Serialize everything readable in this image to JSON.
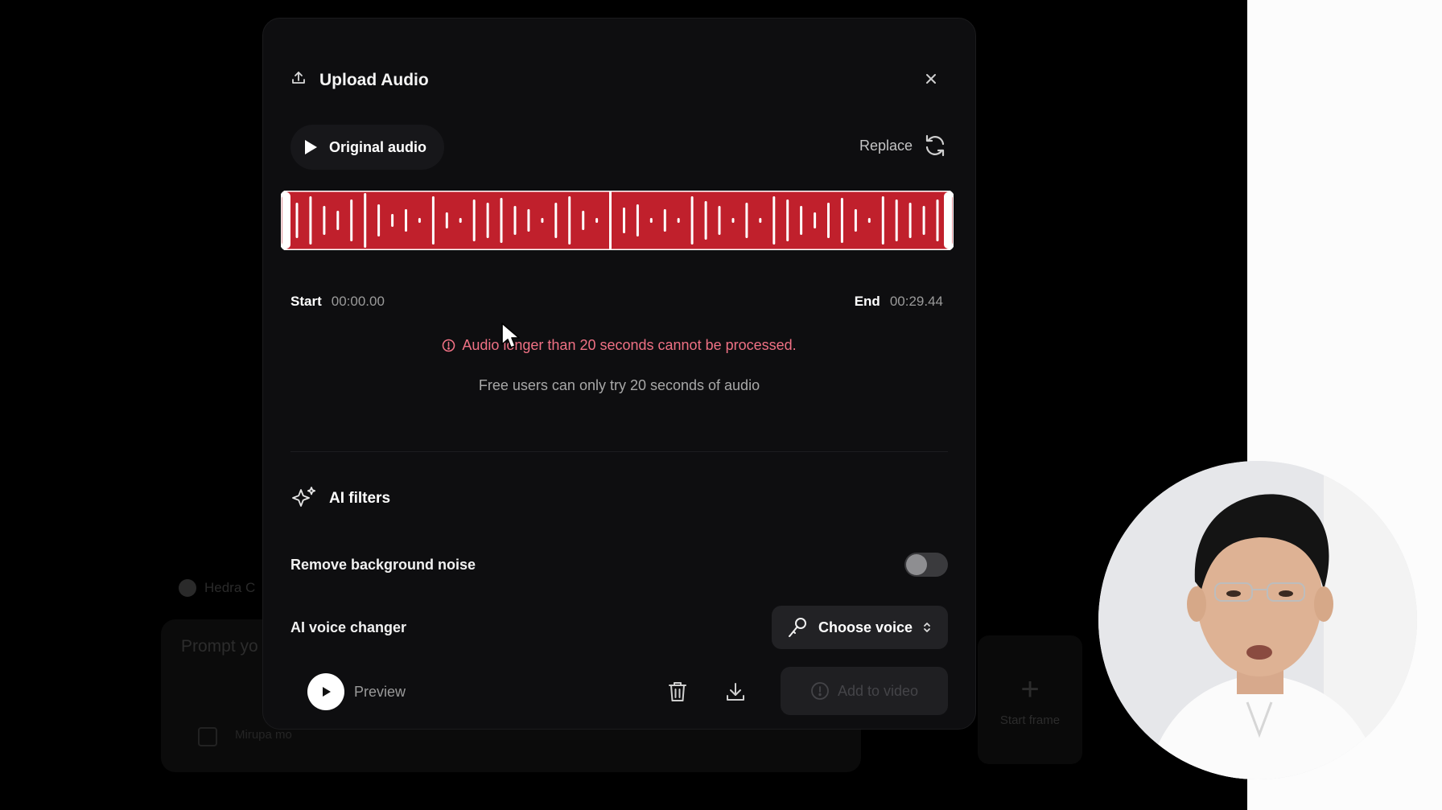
{
  "background": {
    "agent_name": "Hedra C",
    "prompt_placeholder": "Prompt yo",
    "checkbox_label": "Mirupa mo",
    "start_frame_label": "Start frame"
  },
  "modal": {
    "title": "Upload Audio",
    "original_audio_label": "Original audio",
    "replace_label": "Replace",
    "start_label": "Start",
    "start_time": "00:00.00",
    "end_label": "End",
    "end_time": "00:29.44",
    "error_text": "Audio longer than 20 seconds cannot be processed.",
    "info_text": "Free users can only try 20 seconds of audio",
    "ai_filters_label": "AI filters",
    "remove_noise_label": "Remove background noise",
    "remove_noise_enabled": false,
    "voice_changer_label": "AI voice changer",
    "choose_voice_label": "Choose voice",
    "preview_label": "Preview",
    "add_to_video_label": "Add to video"
  },
  "colors": {
    "waveform": "#c0202c",
    "error": "#ef7184"
  },
  "icons": [
    "upload-icon",
    "close-icon",
    "play-icon",
    "refresh-icon",
    "alert-circle-icon",
    "sparkles-icon",
    "microphone-icon",
    "chevron-updown-icon",
    "trash-icon",
    "download-icon"
  ]
}
